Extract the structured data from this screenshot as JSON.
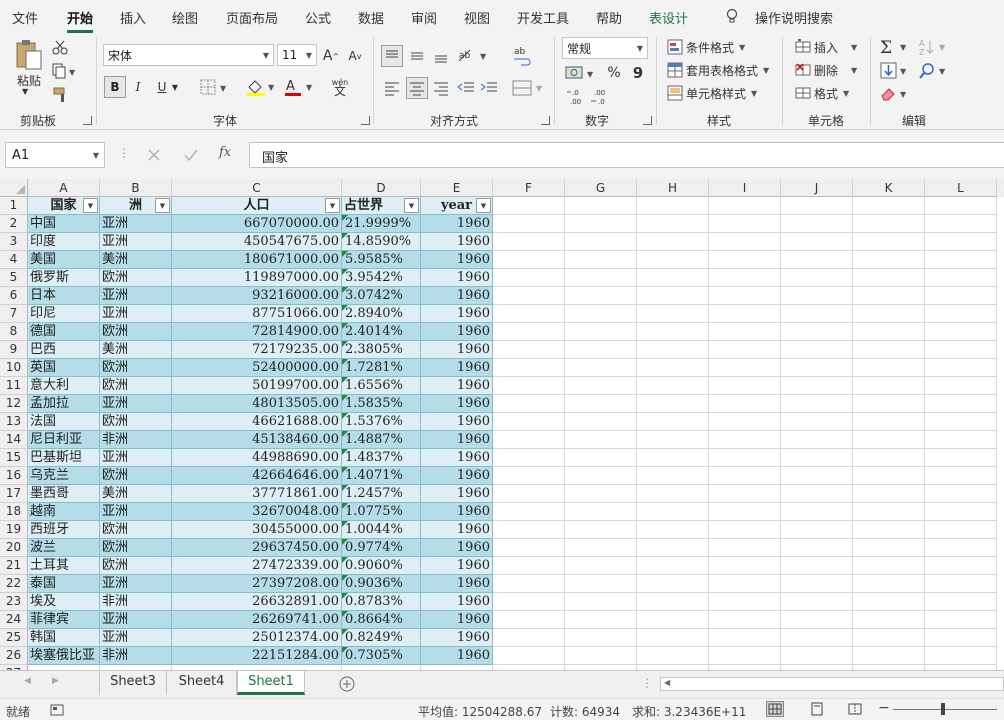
{
  "menu": {
    "tabs": [
      "文件",
      "开始",
      "插入",
      "绘图",
      "页面布局",
      "公式",
      "数据",
      "审阅",
      "视图",
      "开发工具",
      "帮助",
      "表设计"
    ],
    "search_label": "操作说明搜索"
  },
  "ribbon": {
    "clipboard": {
      "paste": "粘贴",
      "label": "剪贴板"
    },
    "font": {
      "name": "宋体",
      "size": "11",
      "bold": "B",
      "italic": "I",
      "underline": "U",
      "grow": "A",
      "shrink": "A",
      "wen": "wén",
      "wen_char": "文",
      "label": "字体"
    },
    "align": {
      "label": "对齐方式"
    },
    "number": {
      "format": "常规",
      "percent": "%",
      "comma": "9",
      "inc_dec": "←.0\n.00",
      "dec_dec": ".00\n→.0",
      "label": "数字"
    },
    "styles": {
      "cond": "条件格式",
      "table": "套用表格格式",
      "cell": "单元格样式",
      "label": "样式"
    },
    "cells": {
      "insert": "插入",
      "delete": "删除",
      "format": "格式",
      "label": "单元格"
    },
    "edit": {
      "label": "编辑"
    }
  },
  "formula_bar": {
    "name_box": "A1",
    "fx": "fx",
    "value": "国家"
  },
  "columns": [
    "A",
    "B",
    "C",
    "D",
    "E",
    "F",
    "G",
    "H",
    "I",
    "J",
    "K",
    "L"
  ],
  "table": {
    "headers": [
      "国家",
      "洲",
      "人口",
      "占世界",
      "year"
    ],
    "rows": [
      [
        "中国",
        "亚洲",
        "667070000.00",
        "21.9999%",
        "1960"
      ],
      [
        "印度",
        "亚洲",
        "450547675.00",
        "14.8590%",
        "1960"
      ],
      [
        "美国",
        "美洲",
        "180671000.00",
        "5.9585%",
        "1960"
      ],
      [
        "俄罗斯",
        "欧洲",
        "119897000.00",
        "3.9542%",
        "1960"
      ],
      [
        "日本",
        "亚洲",
        "93216000.00",
        "3.0742%",
        "1960"
      ],
      [
        "印尼",
        "亚洲",
        "87751066.00",
        "2.8940%",
        "1960"
      ],
      [
        "德国",
        "欧洲",
        "72814900.00",
        "2.4014%",
        "1960"
      ],
      [
        "巴西",
        "美洲",
        "72179235.00",
        "2.3805%",
        "1960"
      ],
      [
        "英国",
        "欧洲",
        "52400000.00",
        "1.7281%",
        "1960"
      ],
      [
        "意大利",
        "欧洲",
        "50199700.00",
        "1.6556%",
        "1960"
      ],
      [
        "孟加拉",
        "亚洲",
        "48013505.00",
        "1.5835%",
        "1960"
      ],
      [
        "法国",
        "欧洲",
        "46621688.00",
        "1.5376%",
        "1960"
      ],
      [
        "尼日利亚",
        "非洲",
        "45138460.00",
        "1.4887%",
        "1960"
      ],
      [
        "巴基斯坦",
        "亚洲",
        "44988690.00",
        "1.4837%",
        "1960"
      ],
      [
        "乌克兰",
        "欧洲",
        "42664646.00",
        "1.4071%",
        "1960"
      ],
      [
        "墨西哥",
        "美洲",
        "37771861.00",
        "1.2457%",
        "1960"
      ],
      [
        "越南",
        "亚洲",
        "32670048.00",
        "1.0775%",
        "1960"
      ],
      [
        "西班牙",
        "欧洲",
        "30455000.00",
        "1.0044%",
        "1960"
      ],
      [
        "波兰",
        "欧洲",
        "29637450.00",
        "0.9774%",
        "1960"
      ],
      [
        "土耳其",
        "欧洲",
        "27472339.00",
        "0.9060%",
        "1960"
      ],
      [
        "泰国",
        "亚洲",
        "27397208.00",
        "0.9036%",
        "1960"
      ],
      [
        "埃及",
        "非洲",
        "26632891.00",
        "0.8783%",
        "1960"
      ],
      [
        "菲律宾",
        "亚洲",
        "26269741.00",
        "0.8664%",
        "1960"
      ],
      [
        "韩国",
        "亚洲",
        "25012374.00",
        "0.8249%",
        "1960"
      ],
      [
        "埃塞俄比亚",
        "非洲",
        "22151284.00",
        "0.7305%",
        "1960"
      ]
    ]
  },
  "sheets": [
    "Sheet3",
    "Sheet4",
    "Sheet1"
  ],
  "active_sheet": "Sheet1",
  "status": {
    "ready": "就绪",
    "average": "平均值: 12504288.67",
    "count": "计数: 64934",
    "sum": "求和: 3.23436E+11"
  },
  "colors": {
    "accent": "#217346",
    "table_band_dark": "#b4dde8",
    "table_band_light": "#ddeff5",
    "error_triangle": "#1e8a3c"
  }
}
